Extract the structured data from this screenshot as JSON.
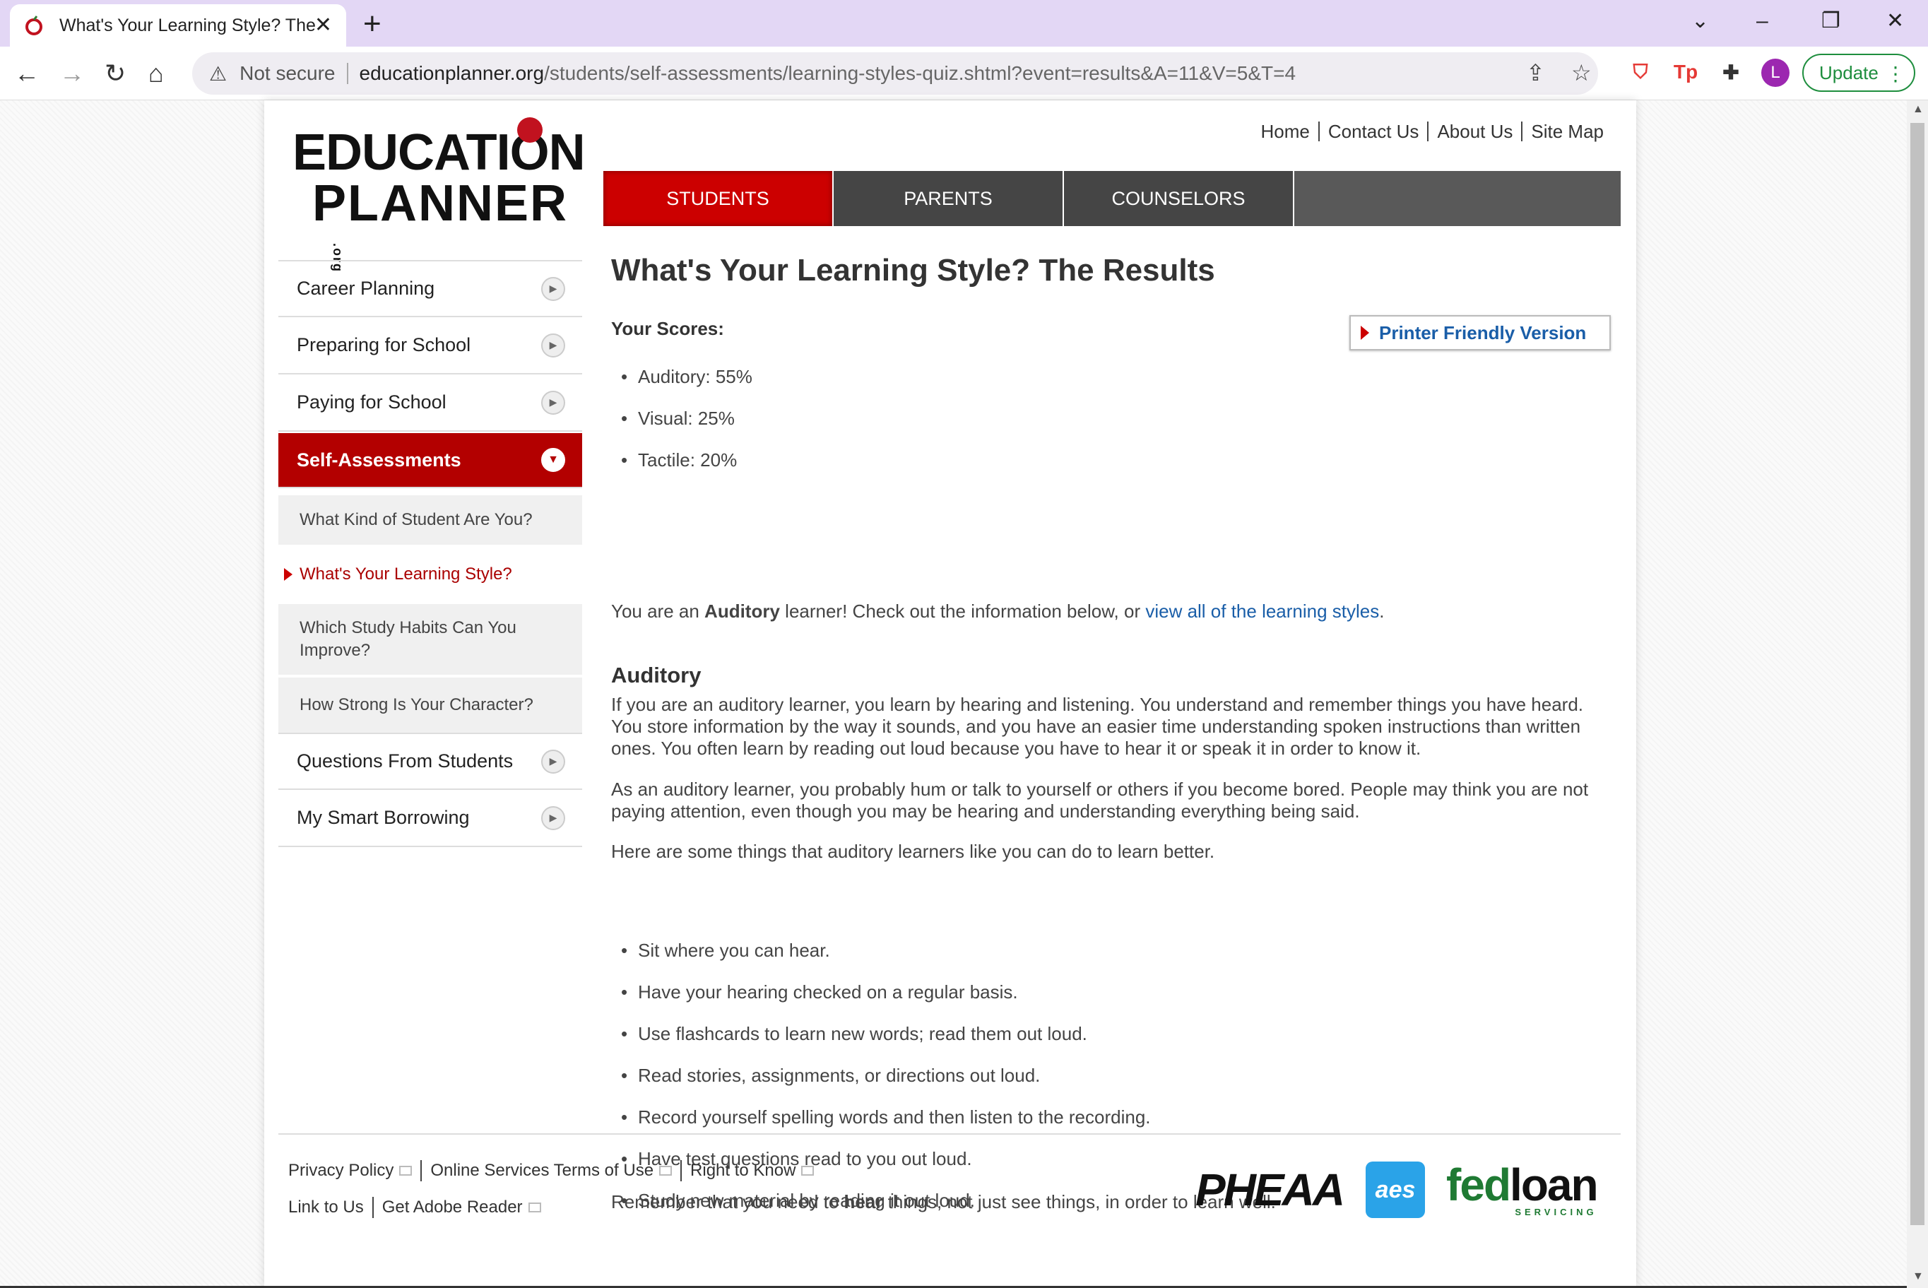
{
  "browser": {
    "tab_title": "What's Your Learning Style? The Results",
    "not_secure": "Not secure",
    "url_host": "educationplanner.org",
    "url_path": "/students/self-assessments/learning-styles-quiz.shtml?event=results&A=11&V=5&T=4",
    "profile_initial": "L",
    "update_label": "Update"
  },
  "header": {
    "logo_line1": "EDUCATION",
    "logo_line2": "PLANNER",
    "logo_org": ".org",
    "top_links": [
      "Home",
      "Contact Us",
      "About Us",
      "Site Map"
    ],
    "nav_tabs": [
      "STUDENTS",
      "PARENTS",
      "COUNSELORS"
    ]
  },
  "sidebar": {
    "items": [
      "Career Planning",
      "Preparing for School",
      "Paying for School",
      "Self-Assessments"
    ],
    "sub_items": [
      "What Kind of Student Are You?",
      "What's Your Learning Style?",
      "Which Study Habits Can You Improve?",
      "How Strong Is Your Character?"
    ],
    "items_after": [
      "Questions From Students",
      "My Smart Borrowing"
    ]
  },
  "main": {
    "title": "What's Your Learning Style? The Results",
    "printer_label": "Printer Friendly Version",
    "scores_label": "Your Scores:",
    "scores": [
      "Auditory: 55%",
      "Visual: 25%",
      "Tactile: 20%"
    ],
    "result_pre": "You are an ",
    "result_bold": "Auditory",
    "result_mid": " learner! Check out the information below, or ",
    "result_link": "view all of the learning styles",
    "result_end": ".",
    "section_heading": "Auditory",
    "para1": "If you are an auditory learner, you learn by hearing and listening. You understand and remember things you have heard. You store information by the way it sounds, and you have an easier time understanding spoken instructions than written ones. You often learn by reading out loud because you have to hear it or speak it in order to know it.",
    "para2": "As an auditory learner, you probably hum or talk to yourself or others if you become bored. People may think you are not paying attention, even though you may be hearing and understanding everything being said.",
    "para3": "Here are some things that auditory learners like you can do to learn better.",
    "tips": [
      "Sit where you can hear.",
      "Have your hearing checked on a regular basis.",
      "Use flashcards to learn new words; read them out loud.",
      "Read stories, assignments, or directions out loud.",
      "Record yourself spelling words and then listen to the recording.",
      "Have test questions read to you out loud.",
      "Study new material by reading it out loud."
    ],
    "closing_pre": "Remember that you need to ",
    "closing_bold": "hear",
    "closing_end": " things, not just see things, in order to learn well."
  },
  "footer": {
    "row1": [
      "Privacy Policy",
      "Online Services Terms of Use",
      "Right to Know"
    ],
    "row2": [
      "Link to Us",
      "Get Adobe Reader"
    ],
    "logo_pheaa": "PHEAA",
    "logo_aes": "aes",
    "logo_fed": "fed",
    "logo_loan": "loan",
    "logo_servicing": "SERVICING"
  }
}
